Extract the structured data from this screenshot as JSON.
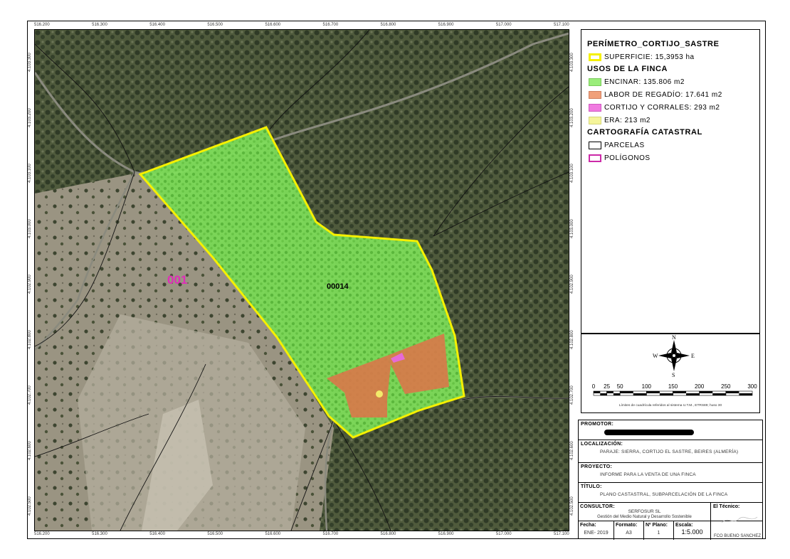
{
  "map": {
    "parcel_main_label": "00014",
    "parcel_side_label": "001",
    "top_ticks": [
      "516.200",
      "516.300",
      "516.400",
      "516.500",
      "516.600",
      "516.700",
      "516.800",
      "516.900",
      "517.000",
      "517.100"
    ],
    "bottom_ticks": [
      "516.200",
      "516.300",
      "516.400",
      "516.500",
      "516.600",
      "516.700",
      "516.800",
      "516.900",
      "517.000",
      "517.100"
    ],
    "left_ticks": [
      "4.103.300",
      "4.103.200",
      "4.103.100",
      "4.103.000",
      "4.102.900",
      "4.102.800",
      "4.102.700",
      "4.102.600",
      "4.102.500"
    ],
    "right_ticks": [
      "4.103.300",
      "4.103.200",
      "4.103.100",
      "4.103.000",
      "4.102.900",
      "4.102.800",
      "4.102.700",
      "4.102.600",
      "4.102.500"
    ]
  },
  "legend": {
    "title_perimeter": "PERÍMETRO_CORTIJO_SASTRE",
    "superficie": "SUPERFICIE: 15,3953 ha",
    "title_usos": "USOS DE LA FINCA",
    "encinar": "ENCINAR: 135.806 m2",
    "labor": "LABOR DE REGADÍO: 17.641 m2",
    "cortijo": "CORTIJO Y CORRALES: 293 m2",
    "era": "ERA: 213 m2",
    "title_catastral": "CARTOGRAFÍA CATASTRAL",
    "parcelas": "PARCELAS",
    "poligonos": "POLÍGONOS",
    "colors": {
      "perimeter": "#f5f000",
      "encinar": "#9aed7a",
      "labor": "#f0a07a",
      "cortijo": "#f07ae0",
      "era": "#f5f59a",
      "poligonos": "#cc2aa8"
    }
  },
  "compass": {
    "n": "N",
    "s": "S",
    "e": "E",
    "w": "W",
    "scale_labels": [
      "0",
      "25",
      "50",
      "100",
      "150",
      "200",
      "250",
      "300"
    ],
    "note": "Límites de cuadrícula referidos al sistema U.T.M., ETRS89; huso 30"
  },
  "info": {
    "promotor_label": "PROMOTOR:",
    "localizacion_label": "LOCALIZACIÓN:",
    "localizacion_value": "PARAJE: SIERRA, CORTIJO EL SASTRE, BEIRES (ALMERÍA)",
    "proyecto_label": "PROYECTO:",
    "proyecto_value": "INFORME PARA LA VENTA DE UNA FINCA",
    "titulo_label": "TÍTULO:",
    "titulo_value": "PLANO CASTASTRAL, SUBPARCELACIÓN DE LA FINCA",
    "consultor_label": "CONSULTOR:",
    "consultor_name": "SERFOSUR SL",
    "consultor_desc": "Gestión del Medio Natural y Desarrollo Sostenible",
    "tecnico_label": "El Técnico:",
    "tecnico_name": "FCO BUENO SANCHEZ",
    "fecha_label": "Fecha:",
    "fecha_value": "ENE- 2019",
    "formato_label": "Formato:",
    "formato_value": "A3",
    "plano_label": "Nº Plano:",
    "plano_value": "1",
    "escala_label": "Escala:",
    "escala_value": "1:5.000"
  }
}
